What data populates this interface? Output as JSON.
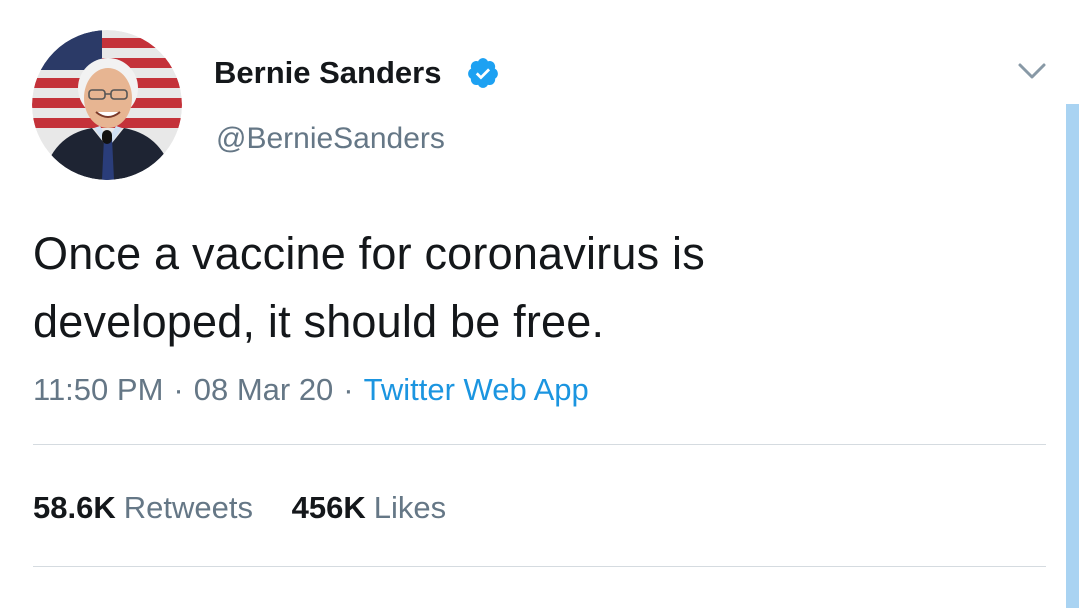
{
  "colors": {
    "text_primary": "#14171a",
    "text_secondary": "#657786",
    "link": "#1b95e0",
    "verified": "#1da1f2",
    "divider": "#d5dbe0",
    "scrollbar": "#a9d3f2"
  },
  "author": {
    "display_name": "Bernie Sanders",
    "handle": "@BernieSanders",
    "verified": true,
    "avatar_icon": "profile-photo",
    "verified_icon": "verified-badge-icon"
  },
  "menu": {
    "icon": "chevron-down-icon"
  },
  "tweet": {
    "text": "Once a vaccine for coronavirus is developed, it should be free.",
    "time": "11:50 PM",
    "date": "08 Mar 20",
    "separator": "·",
    "source": "Twitter Web App"
  },
  "stats": {
    "retweets_count": "58.6K",
    "retweets_label": "Retweets",
    "likes_count": "456K",
    "likes_label": "Likes"
  }
}
